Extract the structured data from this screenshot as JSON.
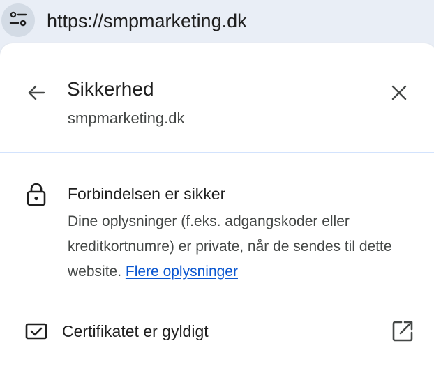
{
  "omnibox": {
    "url": "https://smpmarketing.dk",
    "site_info_icon": "tune-icon"
  },
  "panel": {
    "back_icon": "arrow-back-icon",
    "close_icon": "close-icon",
    "title": "Sikkerhed",
    "subtitle": "smpmarketing.dk",
    "connection": {
      "icon": "lock-icon",
      "title": "Forbindelsen er sikker",
      "description": "Dine oplysninger (f.eks. adgangskoder eller kreditkortnumre) er private, når de sendes til dette website.",
      "link_label": "Flere oplysninger"
    },
    "certificate": {
      "icon": "certificate-icon",
      "label": "Certifikatet er gyldigt",
      "action_icon": "open-in-new-icon"
    }
  },
  "colors": {
    "background": "#e9eef6",
    "panel": "#ffffff",
    "divider": "#d3e3fd",
    "link": "#0b57d0",
    "text_primary": "#1f1f1f",
    "text_secondary": "#444746"
  }
}
